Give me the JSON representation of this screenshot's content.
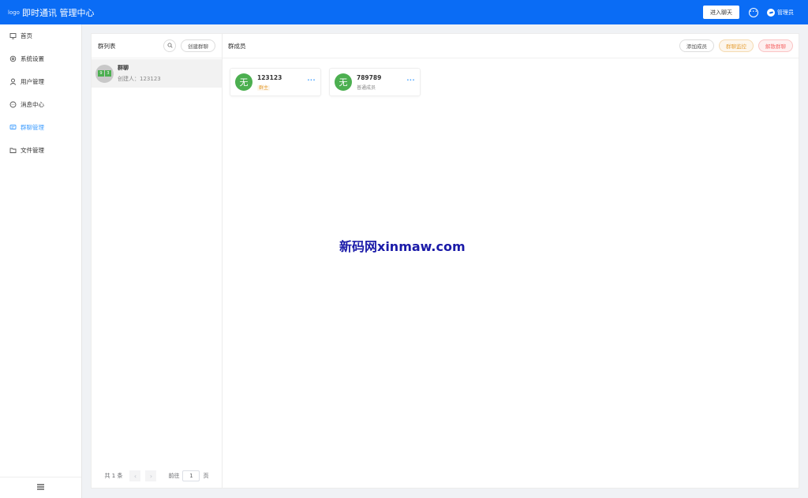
{
  "header": {
    "logo_alt": "logo",
    "title": "即时通讯 管理中心",
    "enter_chat_label": "进入聊天",
    "user_label": "管理员",
    "colors": {
      "primary": "#0a6cf5"
    }
  },
  "sidebar": {
    "items": [
      {
        "label": "首页",
        "icon": "home-icon",
        "active": false
      },
      {
        "label": "系统设置",
        "icon": "gear-icon",
        "active": false
      },
      {
        "label": "用户管理",
        "icon": "user-icon",
        "active": false
      },
      {
        "label": "消息中心",
        "icon": "chat-bubble-icon",
        "active": false
      },
      {
        "label": "群聊管理",
        "icon": "group-chat-icon",
        "active": true
      },
      {
        "label": "文件管理",
        "icon": "folder-icon",
        "active": false
      }
    ],
    "collapse_icon": "hamburger-icon"
  },
  "group_list": {
    "title": "群列表",
    "create_label": "创建群聊",
    "groups": [
      {
        "name": "群聊",
        "creator": "创建人：123123",
        "avatar_chars": [
          "9",
          "3"
        ]
      }
    ],
    "pager": {
      "total_text": "共 1 条",
      "goto_prefix": "前往",
      "page_value": "1",
      "goto_suffix": "页"
    }
  },
  "members": {
    "title": "群成员",
    "add_label": "添加成员",
    "monitor_label": "群聊监控",
    "dissolve_label": "解散群聊",
    "list": [
      {
        "avatar_char": "无",
        "name": "123123",
        "role": "群主",
        "owner": true
      },
      {
        "avatar_char": "无",
        "name": "789789",
        "role": "普通成员",
        "owner": false
      }
    ],
    "more_symbol": "···"
  },
  "watermark": "新码网xinmaw.com"
}
